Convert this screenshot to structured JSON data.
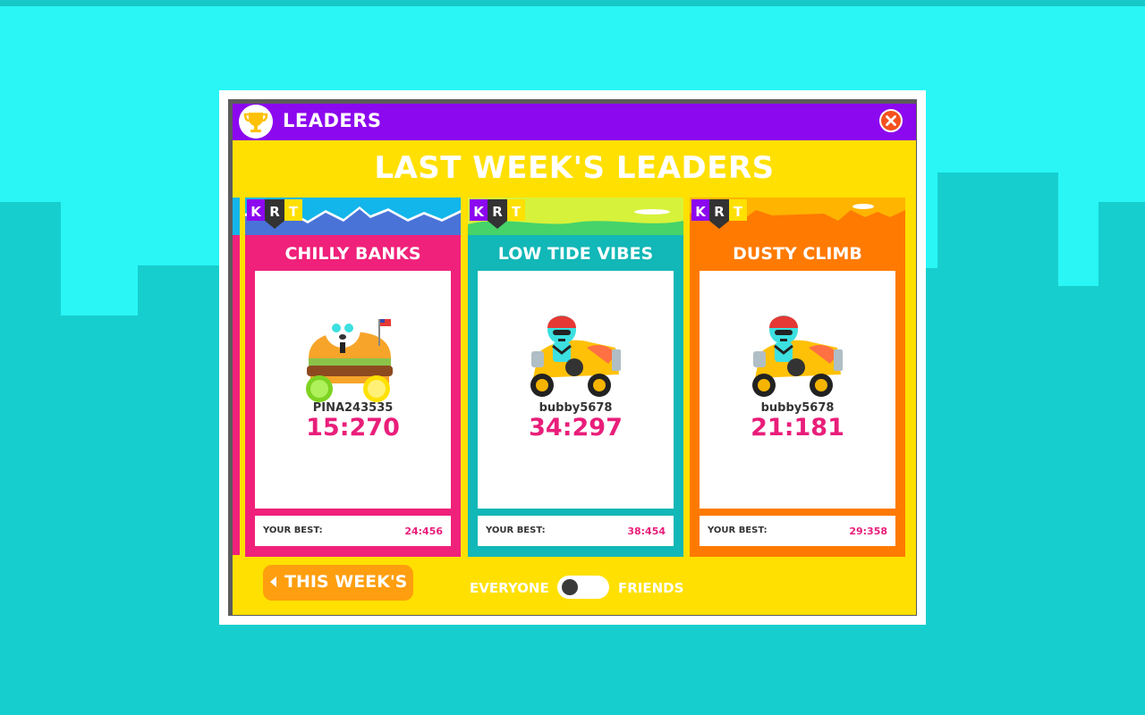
{
  "header": {
    "title": "LEADERS"
  },
  "main_title": "LAST WEEK'S LEADERS",
  "logo_letters": [
    "K",
    "R",
    "T"
  ],
  "cards": [
    {
      "track": "CHILLY BANKS",
      "player": "PINA243535",
      "time": "15:270",
      "best_label": "YOUR BEST:",
      "best_value": "24:456",
      "color": "#f0217a"
    },
    {
      "track": "LOW TIDE VIBES",
      "player": "bubby5678",
      "time": "34:297",
      "best_label": "YOUR BEST:",
      "best_value": "38:454",
      "color": "#12b7b7"
    },
    {
      "track": "DUSTY CLIMB",
      "player": "bubby5678",
      "time": "21:181",
      "best_label": "YOUR BEST:",
      "best_value": "29:358",
      "color": "#ff7a00"
    }
  ],
  "footer": {
    "this_week_label": "THIS WEEK'S",
    "toggle_left": "EVERYONE",
    "toggle_right": "FRIENDS"
  },
  "icons": {
    "header": "trophy-icon",
    "close": "close-icon",
    "back": "chevron-left-icon",
    "car_1": "polar-bear-burger-kart",
    "car_2": "racer-orange-kart",
    "car_3": "racer-orange-kart"
  },
  "colors": {
    "background": "#2af6f6",
    "skyline": "#17cece",
    "header_bar": "#8c08ef",
    "panel": "#ffe000",
    "close": "#f4511e",
    "time": "#e91e7a",
    "button": "#ff9e0e"
  }
}
